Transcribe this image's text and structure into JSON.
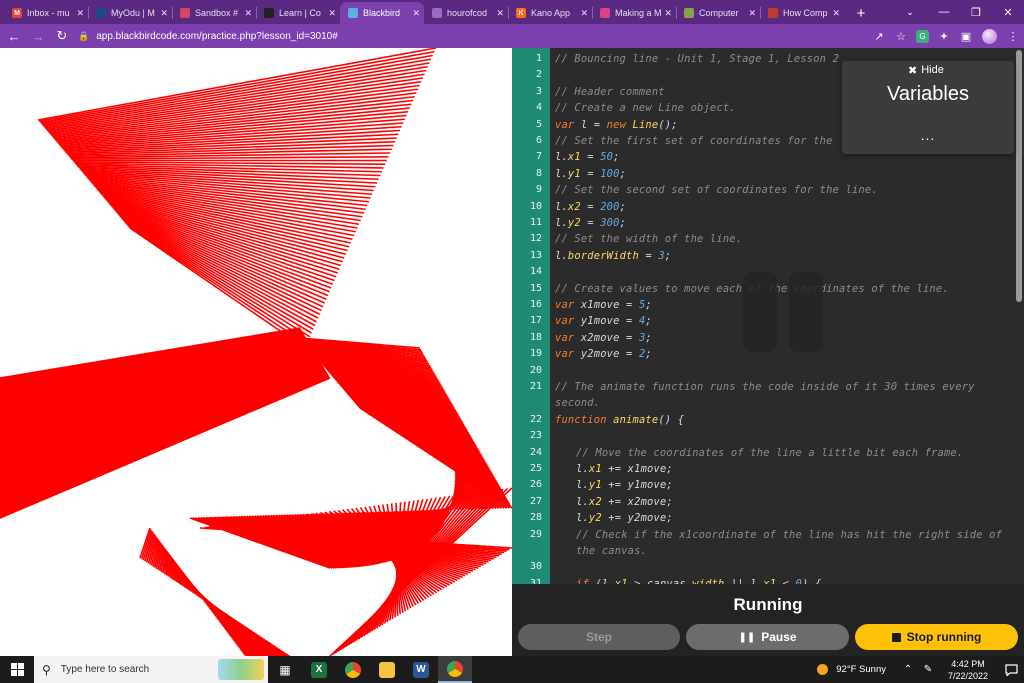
{
  "browser": {
    "tabs": [
      {
        "label": "Inbox - mu",
        "icon": "gmail-icon",
        "color": "#ea4335",
        "glyph": "M"
      },
      {
        "label": "MyOdu | M",
        "icon": "odu-icon",
        "color": "#1a4a8a",
        "glyph": ""
      },
      {
        "label": "Sandbox #",
        "icon": "sandbox-icon",
        "color": "#d9455f",
        "glyph": ""
      },
      {
        "label": "Learn | Co",
        "icon": "learn-icon",
        "color": "#222222",
        "glyph": ""
      },
      {
        "label": "Blackbird",
        "icon": "blackbird-icon",
        "color": "#5ab0e6",
        "glyph": "",
        "active": true
      },
      {
        "label": "hourofcod",
        "icon": "hourofcode-icon",
        "color": "#9b6cc7",
        "glyph": ""
      },
      {
        "label": "Kano App",
        "icon": "kano-icon",
        "color": "#ff6b1a",
        "glyph": "K"
      },
      {
        "label": "Making a M",
        "icon": "making-icon",
        "color": "#e0408a",
        "glyph": ""
      },
      {
        "label": "Computer",
        "icon": "computer-icon",
        "color": "#8aa04a",
        "glyph": ""
      },
      {
        "label": "How Comp",
        "icon": "howcomp-icon",
        "color": "#c0392b",
        "glyph": ""
      }
    ],
    "new_tab_label": "+",
    "url": "app.blackbirdcode.com/practice.php?lesson_id=3010#"
  },
  "editor": {
    "lines": [
      {
        "n": "1",
        "t": 0,
        "html": "<span class='c-comment'>// Bouncing line - Unit 1, Stage 1, Lesson 2</span>"
      },
      {
        "n": "2",
        "t": 0,
        "html": ""
      },
      {
        "n": "3",
        "t": 0,
        "html": "<span class='c-comment'>// Header comment</span>"
      },
      {
        "n": "4",
        "t": 0,
        "html": "<span class='c-comment'>// Create a new Line object.</span>"
      },
      {
        "n": "5",
        "t": 0,
        "html": "<span class='c-kw'>var</span> l = <span class='c-kw'>new</span> <span class='c-fn'>Line</span>();"
      },
      {
        "n": "6",
        "t": 0,
        "html": "<span class='c-comment'>// Set the first set of coordinates for the</span>"
      },
      {
        "n": "7",
        "t": 0,
        "html": "l.<span class='c-prop'>x1</span> = <span class='c-num'>50</span>;"
      },
      {
        "n": "8",
        "t": 0,
        "html": "l.<span class='c-prop'>y1</span> = <span class='c-num'>100</span>;"
      },
      {
        "n": "9",
        "t": 0,
        "html": "<span class='c-comment'>// Set the second set of coordinates for the line.</span>"
      },
      {
        "n": "10",
        "t": 0,
        "html": "l.<span class='c-prop'>x2</span> = <span class='c-num'>200</span>;"
      },
      {
        "n": "11",
        "t": 0,
        "html": "l.<span class='c-prop'>y2</span> = <span class='c-num'>300</span>;"
      },
      {
        "n": "12",
        "t": 0,
        "html": "<span class='c-comment'>// Set the width of the line.</span>"
      },
      {
        "n": "13",
        "t": 0,
        "html": "l.<span class='c-prop'>borderWidth</span> = <span class='c-num'>3</span>;"
      },
      {
        "n": "14",
        "t": 0,
        "html": ""
      },
      {
        "n": "15",
        "t": 0,
        "html": "<span class='c-comment'>// Create values to move each of the coordinates of the line.</span>"
      },
      {
        "n": "16",
        "t": 0,
        "html": "<span class='c-kw'>var</span> x1move = <span class='c-num'>5</span>;"
      },
      {
        "n": "17",
        "t": 0,
        "html": "<span class='c-kw'>var</span> y1move = <span class='c-num'>4</span>;"
      },
      {
        "n": "18",
        "t": 0,
        "html": "<span class='c-kw'>var</span> x2move = <span class='c-num'>3</span>;"
      },
      {
        "n": "19",
        "t": 0,
        "html": "<span class='c-kw'>var</span> y2move = <span class='c-num'>2</span>;"
      },
      {
        "n": "20",
        "t": 0,
        "html": ""
      },
      {
        "n": "21",
        "t": 0,
        "html": "<span class='c-comment'>// The animate function runs the code inside of it 30 times every second.</span>"
      },
      {
        "n": "22",
        "t": 0,
        "html": "<span class='c-kw'>function</span> <span class='c-fn'>animate</span>() {"
      },
      {
        "n": "23",
        "t": 0,
        "html": ""
      },
      {
        "n": "24",
        "t": 1,
        "html": "<span class='c-comment'>// Move the coordinates of the line a little bit each frame.</span>"
      },
      {
        "n": "25",
        "t": 1,
        "html": "l.<span class='c-prop'>x1</span> += x1move;"
      },
      {
        "n": "26",
        "t": 1,
        "html": "l.<span class='c-prop'>y1</span> += y1move;"
      },
      {
        "n": "27",
        "t": 1,
        "html": "l.<span class='c-prop'>x2</span> += x2move;"
      },
      {
        "n": "28",
        "t": 1,
        "html": "l.<span class='c-prop'>y2</span> += y2move;"
      },
      {
        "n": "29",
        "t": 1,
        "html": "<span class='c-comment'>// Check if the x1coordinate of the line has hit the right side of the canvas.</span>"
      },
      {
        "n": "30",
        "t": 0,
        "html": ""
      },
      {
        "n": "31",
        "t": 1,
        "html": "<span class='c-kw'>if</span> (l.<span class='c-prop'>x1</span> &gt; canvas.<span class='c-prop'>width</span> || l.<span class='c-prop'>x1</span> &lt; <span class='c-num'>0</span>) {"
      }
    ]
  },
  "variables_panel": {
    "hide_label": "Hide",
    "title": "Variables",
    "dots": "..."
  },
  "run_panel": {
    "status": "Running",
    "step_label": "Step",
    "pause_label": "Pause",
    "stop_label": "Stop running"
  },
  "taskbar": {
    "search_placeholder": "Type here to search",
    "weather": "92°F  Sunny",
    "time": "4:42 PM",
    "date": "7/22/2022"
  },
  "colors": {
    "line": "#ff0000",
    "gutter": "#1f8a76",
    "stop_button": "#ffc107",
    "chrome": "#7b3fae"
  }
}
